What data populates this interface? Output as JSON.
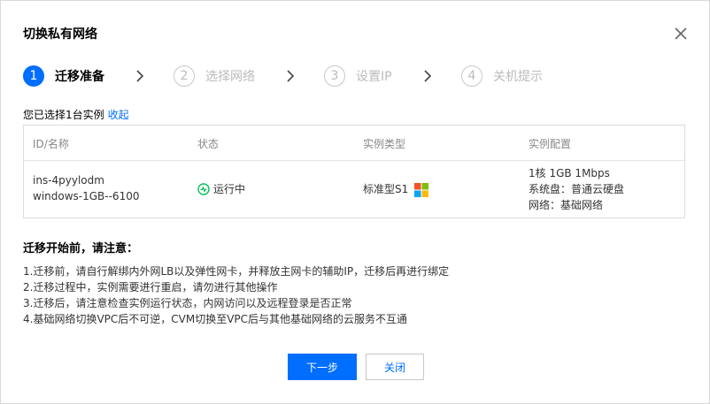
{
  "dialog": {
    "title": "切换私有网络"
  },
  "steps": [
    {
      "num": "1",
      "label": "迁移准备",
      "active": true
    },
    {
      "num": "2",
      "label": "选择网络",
      "active": false
    },
    {
      "num": "3",
      "label": "设置IP",
      "active": false
    },
    {
      "num": "4",
      "label": "关机提示",
      "active": false
    }
  ],
  "selection": {
    "text": "您已选择1台实例",
    "collapse_link": "收起"
  },
  "table": {
    "headers": [
      "ID/名称",
      "状态",
      "实例类型",
      "实例配置"
    ],
    "row": {
      "id": "ins-4pyylodm",
      "name": "windows-1GB--6100",
      "status": "运行中",
      "type": "标准型S1",
      "config": [
        "1核 1GB 1Mbps",
        "系统盘：普通云硬盘",
        "网络：基础网络"
      ]
    }
  },
  "notice": {
    "title": "迁移开始前，请注意：",
    "items": [
      "1.迁移前，请自行解绑内外网LB以及弹性网卡，并释放主网卡的辅助IP，迁移后再进行绑定",
      "2.迁移过程中，实例需要进行重启，请勿进行其他操作",
      "3.迁移后，请注意检查实例运行状态，内网访问以及远程登录是否正常",
      "4.基础网络切换VPC后不可逆，CVM切换至VPC后与其他基础网络的云服务不互通"
    ]
  },
  "buttons": {
    "next": "下一步",
    "close": "关闭"
  },
  "colors": {
    "primary": "#006eff",
    "status_green": "#0abf5b"
  },
  "icons": {
    "close": "close-icon",
    "chevron": "chevron-right-icon",
    "status": "running-status-icon",
    "os": "windows-logo-icon"
  }
}
